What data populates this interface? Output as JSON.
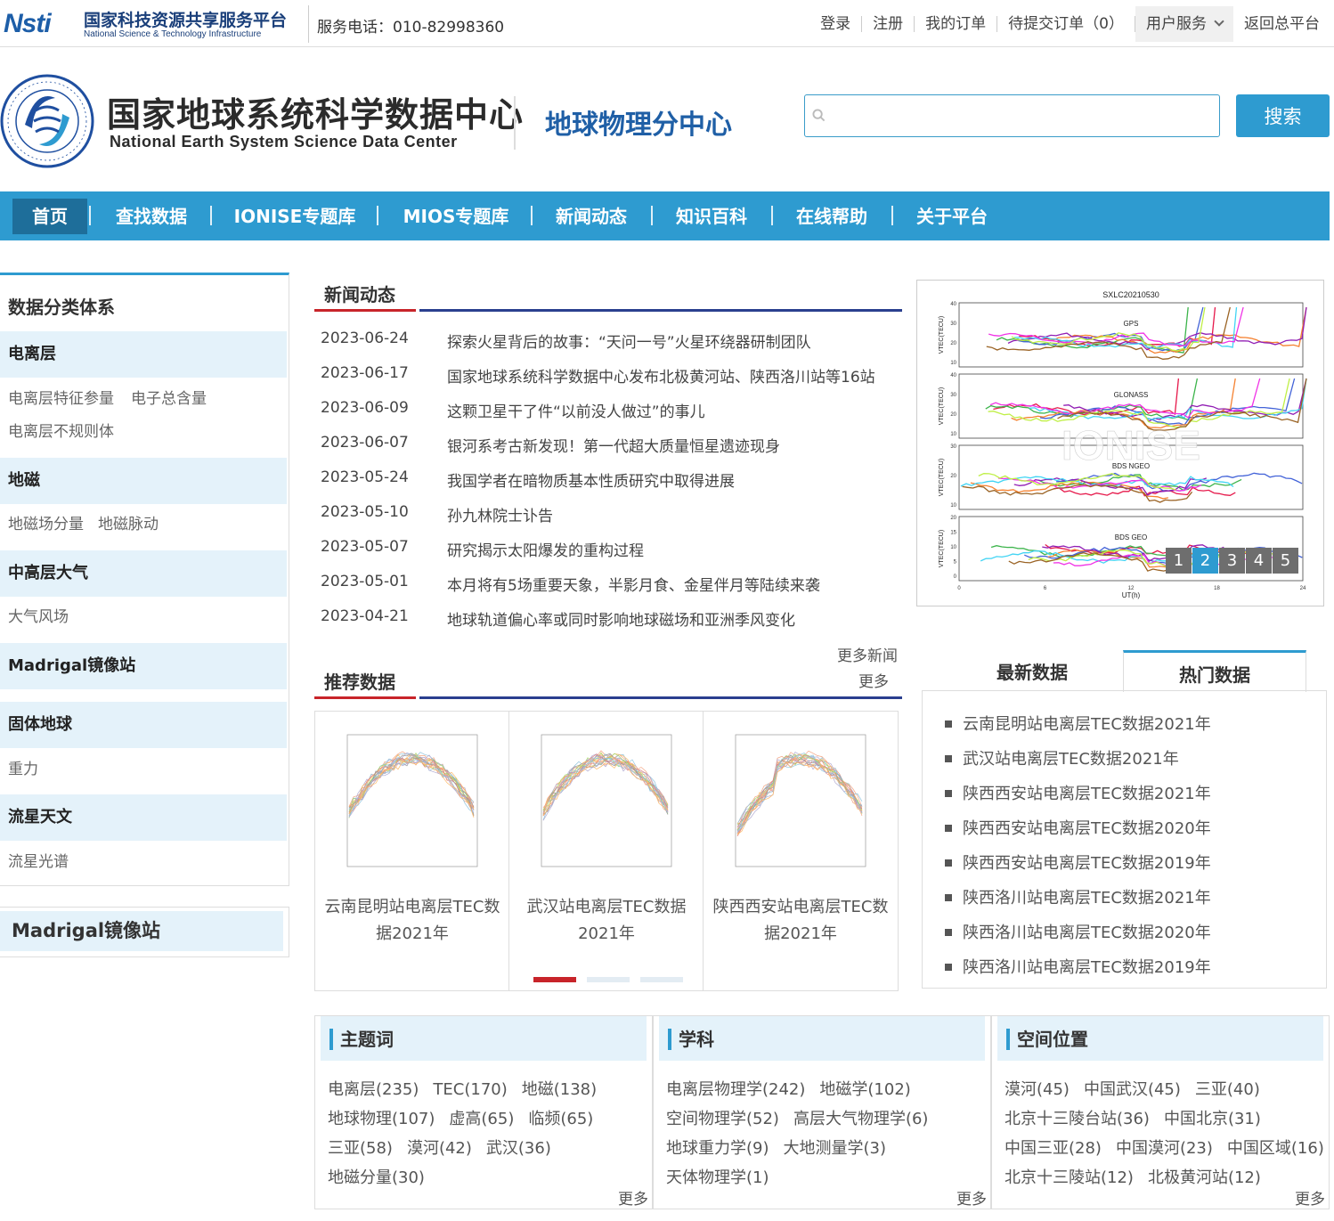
{
  "topbar": {
    "logo_mark": "Nsti",
    "platform_cn": "国家科技资源共享服务平台",
    "platform_en": "National Science & Technology Infrastructure",
    "hotline": "服务电话：010-82998360",
    "links": [
      "登录",
      "注册",
      "我的订单",
      "待提交订单（0）"
    ],
    "user_service": "用户服务",
    "back": "返回总平台"
  },
  "header": {
    "center_cn": "国家地球系统科学数据中心",
    "center_en": "National Earth System Science Data Center",
    "sub_center": "地球物理分中心",
    "search_placeholder": "",
    "search_button": "搜索"
  },
  "nav": [
    "首页",
    "查找数据",
    "IONISE专题库",
    "MIOS专题库",
    "新闻动态",
    "知识百科",
    "在线帮助",
    "关于平台"
  ],
  "sidebar": {
    "title": "数据分类体系",
    "categories": [
      {
        "name": "电离层",
        "items": [
          "电离层特征参量",
          "电子总含量",
          "电离层不规则体"
        ]
      },
      {
        "name": "地磁",
        "items": [
          "地磁场分量",
          "地磁脉动"
        ]
      },
      {
        "name": "中高层大气",
        "items": [
          "大气风场"
        ]
      },
      {
        "name": "Madrigal镜像站",
        "items": []
      },
      {
        "name": "固体地球",
        "items": [
          "重力"
        ]
      },
      {
        "name": "流星天文",
        "items": [
          "流星光谱"
        ]
      }
    ],
    "madrigal": "Madrigal镜像站"
  },
  "news": {
    "title": "新闻动态",
    "items": [
      {
        "date": "2023-06-24",
        "title": "探索火星背后的故事：“天问一号”火星环绕器研制团队"
      },
      {
        "date": "2023-06-17",
        "title": "国家地球系统科学数据中心发布北极黄河站、陕西洛川站等16站"
      },
      {
        "date": "2023-06-09",
        "title": "这颗卫星干了件“以前没人做过”的事儿"
      },
      {
        "date": "2023-06-07",
        "title": "银河系考古新发现！第一代超大质量恒星遗迹现身"
      },
      {
        "date": "2023-05-24",
        "title": "我国学者在暗物质基本性质研究中取得进展"
      },
      {
        "date": "2023-05-10",
        "title": "孙九林院士讣告"
      },
      {
        "date": "2023-05-07",
        "title": "研究揭示太阳爆发的重构过程"
      },
      {
        "date": "2023-05-01",
        "title": "本月将有5场重要天象，半影月食、金星伴月等陆续来袭"
      },
      {
        "date": "2023-04-21",
        "title": "地球轨道偏心率或同时影响地球磁场和亚洲季风变化"
      }
    ],
    "more": "更多新闻"
  },
  "slider": {
    "chart_title": "SXLC20210530",
    "panels": [
      "GPS",
      "GLONASS",
      "BDS NGEO",
      "BDS GEO"
    ],
    "ylabel": "VTEC(TECU)",
    "xlabel": "UT(h)",
    "watermark": "IONISE",
    "x_ticks": [
      "0",
      "6",
      "12",
      "18",
      "24"
    ],
    "y_ticks": [
      [
        "40",
        "30",
        "20",
        "10"
      ],
      [
        "40",
        "30",
        "20",
        "10"
      ],
      [
        "30",
        "20",
        "10"
      ],
      [
        "20",
        "15",
        "10",
        "5",
        "0"
      ]
    ],
    "pages": [
      "1",
      "2",
      "3",
      "4",
      "5"
    ],
    "active_page": 2
  },
  "recommended": {
    "title": "推荐数据",
    "more": "更多",
    "items": [
      "云南昆明站电离层TEC数据2021年",
      "武汉站电离层TEC数据2021年",
      "陕西西安站电离层TEC数据2021年"
    ]
  },
  "data_tabs": {
    "tabs": [
      "最新数据",
      "热门数据"
    ],
    "active": "热门数据",
    "items": [
      "云南昆明站电离层TEC数据2021年",
      "武汉站电离层TEC数据2021年",
      "陕西西安站电离层TEC数据2021年",
      "陕西西安站电离层TEC数据2020年",
      "陕西西安站电离层TEC数据2019年",
      "陕西洛川站电离层TEC数据2021年",
      "陕西洛川站电离层TEC数据2020年",
      "陕西洛川站电离层TEC数据2019年"
    ]
  },
  "tags": {
    "more": "更多",
    "panels": [
      {
        "title": "主题词",
        "lines": [
          [
            "电离层(235)",
            "TEC(170)",
            "地磁(138)"
          ],
          [
            "地球物理(107)",
            "虚高(65)",
            "临频(65)"
          ],
          [
            "三亚(58)",
            "漠河(42)",
            "武汉(36)"
          ],
          [
            "地磁分量(30)"
          ]
        ]
      },
      {
        "title": "学科",
        "lines": [
          [
            "电离层物理学(242)",
            "地磁学(102)"
          ],
          [
            "空间物理学(52)",
            "高层大气物理学(6)"
          ],
          [
            "地球重力学(9)",
            "大地测量学(3)"
          ],
          [
            "天体物理学(1)"
          ]
        ]
      },
      {
        "title": "空间位置",
        "lines": [
          [
            "漠河(45)",
            "中国武汉(45)",
            "三亚(40)"
          ],
          [
            "北京十三陵台站(36)",
            "中国北京(31)"
          ],
          [
            "中国三亚(28)",
            "中国漠河(23)",
            "中国区域(16)"
          ],
          [
            "北京十三陵站(12)",
            "北极黄河站(12)"
          ]
        ]
      }
    ]
  }
}
